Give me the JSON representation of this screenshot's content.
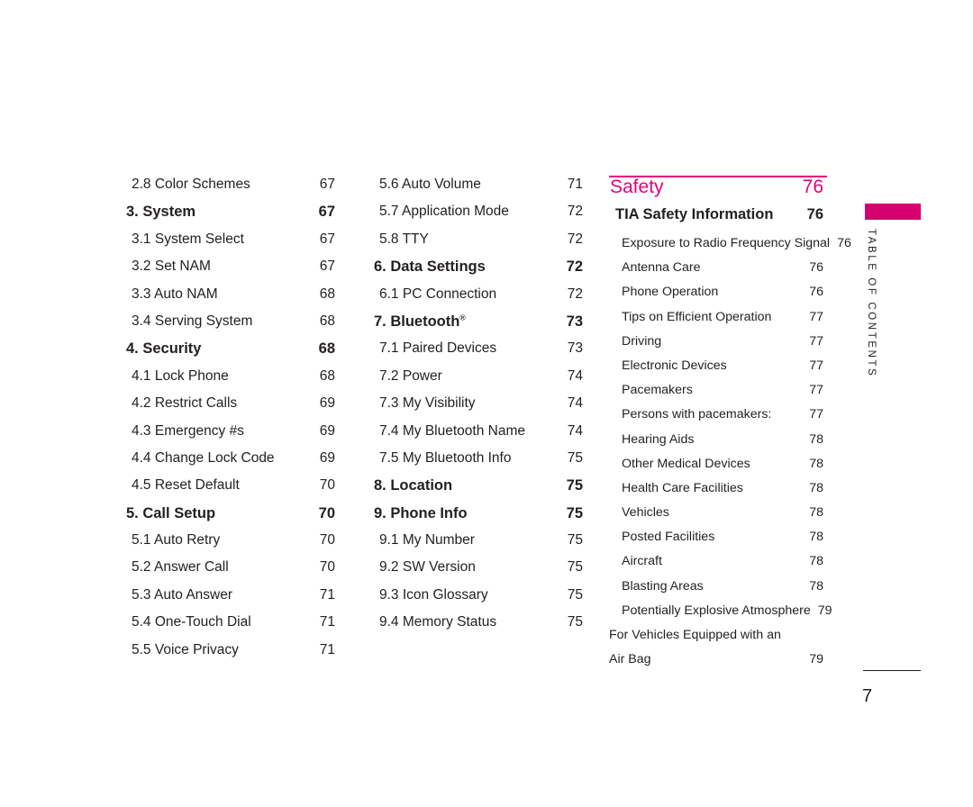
{
  "page": {
    "folio": "7",
    "side_tab_label": "TABLE OF CONTENTS",
    "accent_color": "#e5007e",
    "tab_color": "#d6006e",
    "text_color": "#231f20"
  },
  "columns": [
    {
      "id": "column-1",
      "entries": [
        {
          "type": "sub",
          "label": "2.8 Color Schemes",
          "page": "67"
        },
        {
          "type": "section",
          "label": "3. System",
          "page": "67"
        },
        {
          "type": "sub",
          "label": "3.1 System Select",
          "page": "67"
        },
        {
          "type": "sub",
          "label": "3.2 Set NAM",
          "page": "67"
        },
        {
          "type": "sub",
          "label": "3.3 Auto NAM",
          "page": "68"
        },
        {
          "type": "sub",
          "label": "3.4 Serving System",
          "page": "68"
        },
        {
          "type": "section",
          "label": "4. Security",
          "page": "68"
        },
        {
          "type": "sub",
          "label": "4.1 Lock Phone",
          "page": "68"
        },
        {
          "type": "sub",
          "label": "4.2 Restrict Calls",
          "page": "69"
        },
        {
          "type": "sub",
          "label": "4.3 Emergency #s",
          "page": "69"
        },
        {
          "type": "sub",
          "label": "4.4 Change Lock Code",
          "page": "69"
        },
        {
          "type": "sub",
          "label": "4.5 Reset Default",
          "page": "70"
        },
        {
          "type": "section",
          "label": "5. Call Setup",
          "page": "70"
        },
        {
          "type": "sub",
          "label": "5.1 Auto Retry",
          "page": "70"
        },
        {
          "type": "sub",
          "label": "5.2 Answer Call",
          "page": "70"
        },
        {
          "type": "sub",
          "label": "5.3 Auto Answer",
          "page": "71"
        },
        {
          "type": "sub",
          "label": "5.4 One-Touch Dial",
          "page": "71"
        },
        {
          "type": "sub",
          "label": "5.5 Voice Privacy",
          "page": "71"
        }
      ]
    },
    {
      "id": "column-2",
      "entries": [
        {
          "type": "sub",
          "label": "5.6 Auto Volume",
          "page": "71"
        },
        {
          "type": "sub",
          "label": "5.7 Application Mode",
          "page": "72"
        },
        {
          "type": "sub",
          "label": "5.8 TTY",
          "page": "72"
        },
        {
          "type": "section",
          "label": "6. Data Settings",
          "page": "72"
        },
        {
          "type": "sub",
          "label": "6.1 PC Connection",
          "page": "72"
        },
        {
          "type": "section",
          "label": "7. Bluetooth",
          "trademark": "®",
          "page": "73"
        },
        {
          "type": "sub",
          "label": "7.1 Paired Devices",
          "page": "73"
        },
        {
          "type": "sub",
          "label": "7.2 Power",
          "page": "74"
        },
        {
          "type": "sub",
          "label": "7.3 My Visibility",
          "page": "74"
        },
        {
          "type": "sub",
          "label": "7.4 My Bluetooth Name",
          "page": "74"
        },
        {
          "type": "sub",
          "label": "7.5 My Bluetooth Info",
          "page": "75"
        },
        {
          "type": "section",
          "label": "8. Location",
          "page": "75"
        },
        {
          "type": "section",
          "label": "9. Phone Info",
          "page": "75"
        },
        {
          "type": "sub",
          "label": "9.1 My Number",
          "page": "75"
        },
        {
          "type": "sub",
          "label": "9.2 SW Version",
          "page": "75"
        },
        {
          "type": "sub",
          "label": "9.3 Icon Glossary",
          "page": "75"
        },
        {
          "type": "sub",
          "label": "9.4 Memory Status",
          "page": "75"
        }
      ]
    },
    {
      "id": "column-3",
      "entries": [
        {
          "type": "chapter",
          "label": "Safety",
          "page": "76"
        },
        {
          "type": "section",
          "label": "TIA Safety Information",
          "page": "76"
        },
        {
          "type": "sub",
          "label": "Exposure to Radio Frequency Signal",
          "page": "76"
        },
        {
          "type": "sub",
          "label": "Antenna Care",
          "page": "76"
        },
        {
          "type": "sub",
          "label": "Phone Operation",
          "page": "76"
        },
        {
          "type": "sub",
          "label": "Tips on Efficient Operation",
          "page": "77"
        },
        {
          "type": "sub",
          "label": "Driving",
          "page": "77"
        },
        {
          "type": "sub",
          "label": "Electronic Devices",
          "page": "77"
        },
        {
          "type": "sub",
          "label": "Pacemakers",
          "page": "77"
        },
        {
          "type": "sub",
          "label": "Persons with pacemakers:",
          "page": "77"
        },
        {
          "type": "sub",
          "label": "Hearing Aids",
          "page": "78"
        },
        {
          "type": "sub",
          "label": "Other Medical Devices",
          "page": "78"
        },
        {
          "type": "sub",
          "label": "Health Care Facilities",
          "page": "78"
        },
        {
          "type": "sub",
          "label": "Vehicles",
          "page": "78"
        },
        {
          "type": "sub",
          "label": "Posted Facilities",
          "page": "78"
        },
        {
          "type": "sub",
          "label": "Aircraft",
          "page": "78"
        },
        {
          "type": "sub",
          "label": "Blasting Areas",
          "page": "78"
        },
        {
          "type": "sub",
          "label": "Potentially Explosive Atmosphere",
          "page": "79"
        },
        {
          "type": "wrap",
          "label_line1": "For Vehicles Equipped with an",
          "label_line2": "Air Bag",
          "page": "79"
        }
      ]
    }
  ]
}
